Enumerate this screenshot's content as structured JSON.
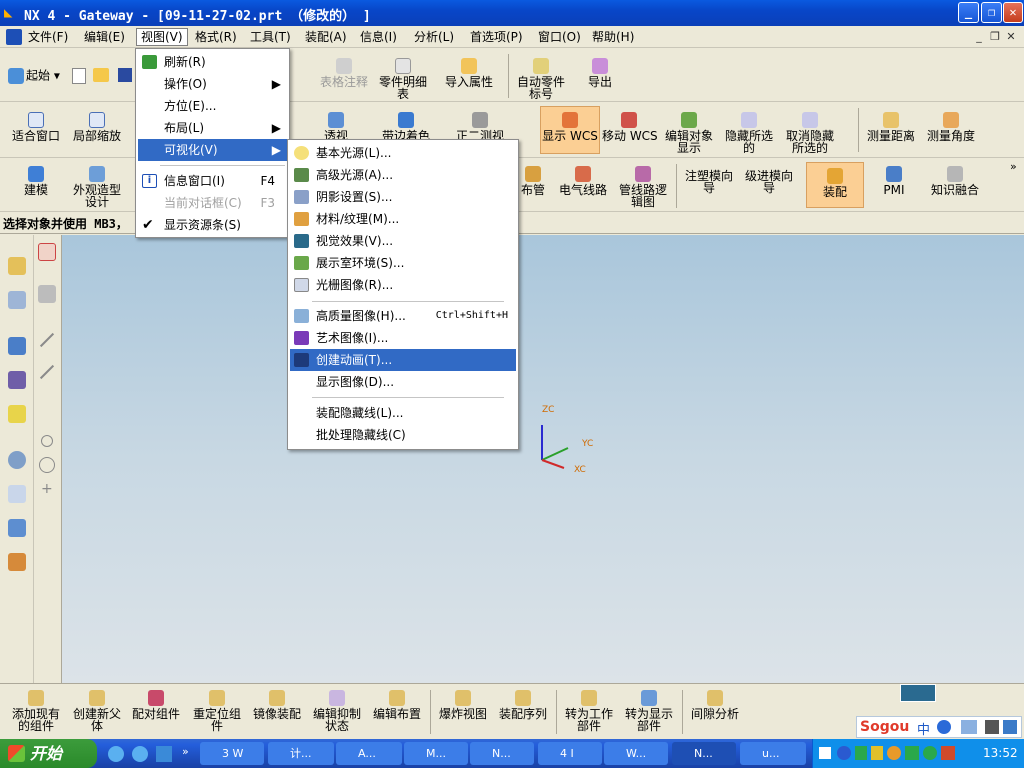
{
  "window": {
    "title": "NX 4 - Gateway - [09-11-27-02.prt （修改的） ]"
  },
  "menubar": {
    "items": [
      "文件(F)",
      "编辑(E)",
      "视图(V)",
      "格式(R)",
      "工具(T)",
      "装配(A)",
      "信息(I)",
      "分析(L)",
      "首选项(P)",
      "窗口(O)",
      "帮助(H)"
    ]
  },
  "toolbar1": {
    "start": "起始",
    "items": [
      "表格注释",
      "零件明细\n表",
      "导入属性",
      "自动零件\n标号",
      "导出"
    ]
  },
  "toolbar2": {
    "items": [
      "适合窗口",
      "局部缩放",
      "透视",
      "带边着色",
      "正二测视",
      "显示 WCS",
      "移动 WCS",
      "编辑对象\n显示",
      "隐藏所选\n的",
      "取消隐藏\n所选的",
      "测量距离",
      "测量角度"
    ]
  },
  "toolbar3": {
    "items": [
      "建模",
      "外观造型\n设计",
      "布管",
      "电气线路",
      "管线路逻\n辑图",
      "注塑模向\n导",
      "级进模向\n导",
      "装配",
      "PMI",
      "知识融合"
    ]
  },
  "statusline": {
    "text": "选择对象并使用 MB3，"
  },
  "view_menu": {
    "items": [
      {
        "label": "刷新(R)",
        "icon": "refresh-icon"
      },
      {
        "label": "操作(O)",
        "submenu": true
      },
      {
        "label": "方位(E)..."
      },
      {
        "label": "布局(L)",
        "submenu": true
      },
      {
        "label": "可视化(V)",
        "submenu": true,
        "selected": true
      },
      {
        "label": "信息窗口(I)",
        "accel": "F4",
        "icon": "info-icon"
      },
      {
        "label": "当前对话框(C)",
        "accel": "F3",
        "disabled": true
      },
      {
        "label": "显示资源条(S)",
        "checked": true
      }
    ]
  },
  "vis_menu": {
    "items": [
      {
        "label": "基本光源(L)...",
        "icon": "bulb-icon"
      },
      {
        "label": "高级光源(A)...",
        "icon": "spotlight-icon"
      },
      {
        "label": "阴影设置(S)...",
        "icon": "shadow-icon"
      },
      {
        "label": "材料/纹理(M)...",
        "icon": "material-icon"
      },
      {
        "label": "视觉效果(V)...",
        "icon": "visual-effect-icon"
      },
      {
        "label": "展示室环境(S)...",
        "icon": "showroom-icon"
      },
      {
        "label": "光栅图像(R)...",
        "icon": "raster-icon"
      },
      {
        "label": "高质量图像(H)...",
        "accel": "Ctrl+Shift+H",
        "icon": "hq-image-icon"
      },
      {
        "label": "艺术图像(I)...",
        "icon": "artistic-icon"
      },
      {
        "label": "创建动画(T)...",
        "icon": "animation-icon",
        "selected": true
      },
      {
        "label": "显示图像(D)..."
      },
      {
        "label": "装配隐藏线(L)..."
      },
      {
        "label": "批处理隐藏线(C)"
      }
    ]
  },
  "triad": {
    "zc": "ZC",
    "yc": "YC",
    "xc": "XC"
  },
  "bottombar": {
    "items": [
      "添加现有\n的组件",
      "创建新父\n体",
      "配对组件",
      "重定位组\n件",
      "镜像装配",
      "编辑抑制\n状态",
      "编辑布置",
      "爆炸视图",
      "装配序列",
      "转为工作\n部件",
      "转为显示\n部件",
      "间隙分析"
    ]
  },
  "taskbar": {
    "start": "开始",
    "tasks": [
      "3 W",
      "计...",
      "A...",
      "M...",
      "N...",
      "4 I",
      "W...",
      "N...",
      "u..."
    ],
    "clock": "13:52"
  },
  "ime": {
    "brand": "Sogou",
    "mode": "中"
  },
  "colors": {
    "title_blue": "#0a5ae0",
    "menu_select": "#316ac5",
    "highlight_orange": "#fbcf94",
    "viewport_top": "#a9c6db"
  }
}
